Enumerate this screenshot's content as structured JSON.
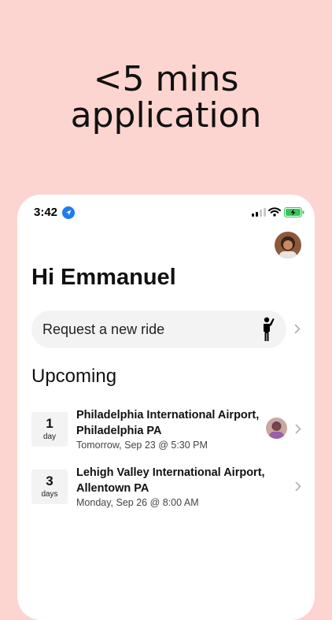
{
  "promo": {
    "headline_line1": "<5 mins",
    "headline_line2": "application",
    "background_color": "#FDD5D0"
  },
  "status_bar": {
    "time": "3:42",
    "icons": [
      "location-arrow-icon",
      "signal-icon",
      "wifi-icon",
      "battery-charging-icon"
    ]
  },
  "header": {
    "avatar_icon": "user-avatar"
  },
  "greeting": "Hi Emmanuel",
  "request_ride": {
    "label": "Request a new ride",
    "icon": "person-hailing-icon"
  },
  "upcoming": {
    "title": "Upcoming",
    "trips": [
      {
        "day_count": "1",
        "day_unit": "day",
        "destination": "Philadelphia International Airport, Philadelphia PA",
        "datetime": "Tomorrow, Sep 23 @ 5:30 PM",
        "has_driver_avatar": true
      },
      {
        "day_count": "3",
        "day_unit": "days",
        "destination": "Lehigh Valley International Airport, Allentown PA",
        "datetime": "Monday, Sep 26 @ 8:00 AM",
        "has_driver_avatar": false
      }
    ]
  }
}
